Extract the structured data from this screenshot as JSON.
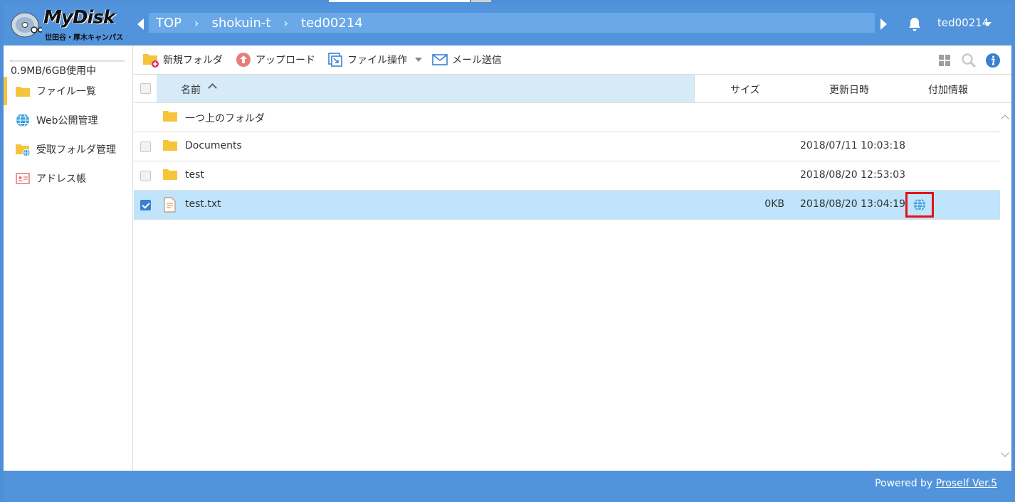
{
  "header": {
    "logo_text": "MyDisk",
    "logo_subtitle": "世田谷・厚木キャンパス",
    "breadcrumb": [
      "TOP",
      "shokuin-t",
      "ted00214"
    ],
    "breadcrumb_separator": "›",
    "user_name": "ted00214"
  },
  "sidebar": {
    "usage_text": "0.9MB/6GB使用中",
    "usage_fraction": 0.00015,
    "items": [
      {
        "label": "ファイル一覧",
        "icon": "folder-icon",
        "active": true
      },
      {
        "label": "Web公開管理",
        "icon": "globe-icon",
        "active": false
      },
      {
        "label": "受取フォルダ管理",
        "icon": "shared-folder-icon",
        "active": false
      },
      {
        "label": "アドレス帳",
        "icon": "address-card-icon",
        "active": false
      }
    ]
  },
  "toolbar": {
    "new_folder": "新規フォルダ",
    "upload": "アップロード",
    "file_ops": "ファイル操作",
    "send_mail": "メール送信"
  },
  "table": {
    "headers": {
      "name": "名前",
      "size": "サイズ",
      "modified": "更新日時",
      "info": "付加情報"
    },
    "rows": [
      {
        "type": "parent",
        "name": "一つ上のフォルダ",
        "size": "",
        "modified": "",
        "checkbox": false,
        "checked": false,
        "selected": false,
        "info_icon": ""
      },
      {
        "type": "folder",
        "name": "Documents",
        "size": "",
        "modified": "2018/07/11 10:03:18",
        "checkbox": true,
        "checked": false,
        "selected": false,
        "info_icon": ""
      },
      {
        "type": "folder",
        "name": "test",
        "size": "",
        "modified": "2018/08/20 12:53:03",
        "checkbox": true,
        "checked": false,
        "selected": false,
        "info_icon": ""
      },
      {
        "type": "file",
        "name": "test.txt",
        "size": "0KB",
        "modified": "2018/08/20 13:04:19",
        "checkbox": true,
        "checked": true,
        "selected": true,
        "info_icon": "web-published-globe-icon"
      }
    ]
  },
  "footer": {
    "powered_by": "Powered by",
    "link": "Proself Ver.5"
  },
  "colors": {
    "brand_blue": "#5294dc",
    "breadcrumb_bg": "#6aa8e8",
    "selected_row": "#bfe4fb",
    "header_name_col": "#d6eaf8",
    "active_marker": "#f6c43b",
    "highlight_box": "#e0121c",
    "folder": "#f6c43b"
  }
}
